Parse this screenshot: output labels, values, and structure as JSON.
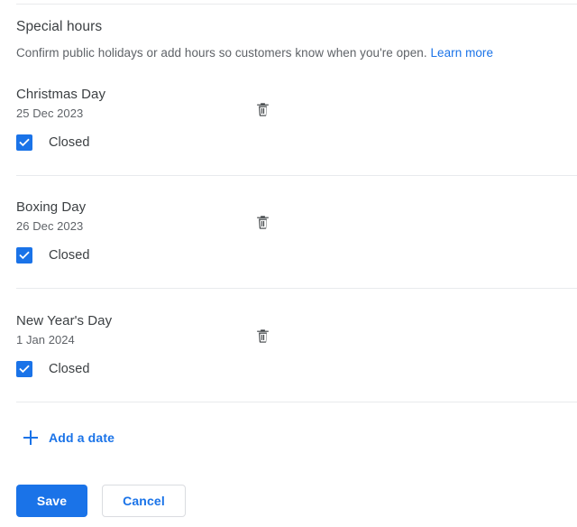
{
  "section": {
    "title": "Special hours",
    "description": "Confirm public holidays or add hours so customers know when you're open.",
    "learn_more_label": "Learn more",
    "link_color": "#1a73e8"
  },
  "entries": [
    {
      "title": "Christmas Day",
      "date": "25 Dec 2023",
      "closed_label": "Closed",
      "checked": true,
      "delete_icon": "trash-icon"
    },
    {
      "title": "Boxing Day",
      "date": "26 Dec 2023",
      "closed_label": "Closed",
      "checked": true,
      "delete_icon": "trash-icon"
    },
    {
      "title": "New Year's Day",
      "date": "1 Jan 2024",
      "closed_label": "Closed",
      "checked": true,
      "delete_icon": "trash-icon"
    }
  ],
  "add_date": {
    "label": "Add a date",
    "icon": "plus-icon"
  },
  "actions": {
    "save_label": "Save",
    "cancel_label": "Cancel",
    "primary_color": "#1a73e8",
    "border_color": "#dadce0"
  },
  "colors": {
    "text_primary": "#3c4043",
    "text_secondary": "#5f6368",
    "divider": "#e8eaed",
    "checkbox_fill": "#1a73e8",
    "icon": "#3c4043"
  }
}
